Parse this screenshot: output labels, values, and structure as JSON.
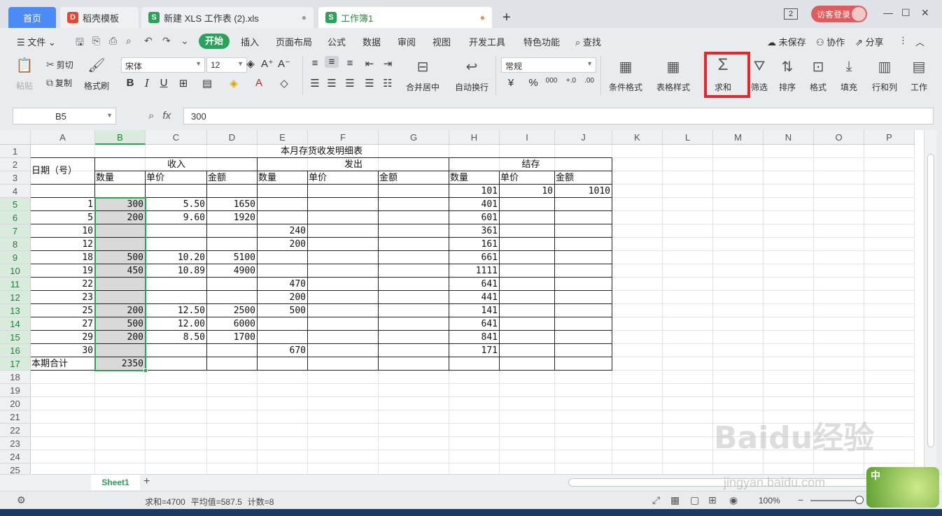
{
  "tabs": {
    "home": "首页",
    "daoke": "稻壳模板",
    "xls": "新建 XLS 工作表 (2).xls",
    "book": "工作簿1",
    "add": "+"
  },
  "titlebar": {
    "window_count": "2",
    "visitor_login": "访客登录"
  },
  "menu": {
    "file": "文件",
    "start": "开始",
    "insert": "插入",
    "page_layout": "页面布局",
    "formula": "公式",
    "data": "数据",
    "review": "审阅",
    "view": "视图",
    "developer": "开发工具",
    "features": "特色功能",
    "search": "查找",
    "unsaved": "未保存",
    "collab": "协作",
    "share": "分享"
  },
  "ribbon": {
    "paste": "粘贴",
    "cut": "剪切",
    "copy": "复制",
    "format_painter": "格式刷",
    "font_name": "宋体",
    "font_size": "12",
    "merge_center": "合并居中",
    "auto_wrap": "自动换行",
    "number_format": "常规",
    "cond_format": "条件格式",
    "table_style": "表格样式",
    "sum": "求和",
    "filter": "筛选",
    "sort": "排序",
    "format": "格式",
    "fill": "填充",
    "rows_cols": "行和列",
    "worksheet": "工作"
  },
  "formula_bar": {
    "cell_ref": "B5",
    "fx": "fx",
    "value": "300"
  },
  "columns": [
    "A",
    "B",
    "C",
    "D",
    "E",
    "F",
    "G",
    "H",
    "I",
    "J",
    "K",
    "L",
    "M",
    "N",
    "O",
    "P"
  ],
  "rows": [
    "1",
    "2",
    "3",
    "4",
    "5",
    "6",
    "7",
    "8",
    "9",
    "10",
    "11",
    "12",
    "13",
    "14",
    "15",
    "16",
    "17",
    "18",
    "19",
    "20",
    "21",
    "22",
    "23",
    "24",
    "25"
  ],
  "table": {
    "title": "本月存货收发明细表",
    "date_header": "日期（号）",
    "income": "收入",
    "issue": "发出",
    "balance": "结存",
    "qty": "数量",
    "price": "单价",
    "amount": "金额",
    "total_label": "本期合计",
    "opening": {
      "qty": "101",
      "price": "10",
      "amount": "1010"
    },
    "data_rows": [
      {
        "day": "1",
        "in_qty": "300",
        "in_price": "5.50",
        "in_amt": "1650",
        "out_qty": "",
        "bal_qty": "401"
      },
      {
        "day": "5",
        "in_qty": "200",
        "in_price": "9.60",
        "in_amt": "1920",
        "out_qty": "",
        "bal_qty": "601"
      },
      {
        "day": "10",
        "in_qty": "",
        "in_price": "",
        "in_amt": "",
        "out_qty": "240",
        "bal_qty": "361"
      },
      {
        "day": "12",
        "in_qty": "",
        "in_price": "",
        "in_amt": "",
        "out_qty": "200",
        "bal_qty": "161"
      },
      {
        "day": "18",
        "in_qty": "500",
        "in_price": "10.20",
        "in_amt": "5100",
        "out_qty": "",
        "bal_qty": "661"
      },
      {
        "day": "19",
        "in_qty": "450",
        "in_price": "10.89",
        "in_amt": "4900",
        "out_qty": "",
        "bal_qty": "1111"
      },
      {
        "day": "22",
        "in_qty": "",
        "in_price": "",
        "in_amt": "",
        "out_qty": "470",
        "bal_qty": "641"
      },
      {
        "day": "23",
        "in_qty": "",
        "in_price": "",
        "in_amt": "",
        "out_qty": "200",
        "bal_qty": "441"
      },
      {
        "day": "25",
        "in_qty": "200",
        "in_price": "12.50",
        "in_amt": "2500",
        "out_qty": "500",
        "bal_qty": "141"
      },
      {
        "day": "27",
        "in_qty": "500",
        "in_price": "12.00",
        "in_amt": "6000",
        "out_qty": "",
        "bal_qty": "641"
      },
      {
        "day": "29",
        "in_qty": "200",
        "in_price": "8.50",
        "in_amt": "1700",
        "out_qty": "",
        "bal_qty": "841"
      },
      {
        "day": "30",
        "in_qty": "",
        "in_price": "",
        "in_amt": "",
        "out_qty": "670",
        "bal_qty": "171"
      }
    ],
    "total_qty": "2350"
  },
  "sheets": {
    "active": "Sheet1",
    "add": "+"
  },
  "status": {
    "sum": "求和=4700",
    "avg": "平均值=587.5",
    "count": "计数=8",
    "zoom": "100%"
  },
  "watermark": {
    "brand": "Baidu经验",
    "url": "jingyan.baidu.com"
  },
  "ime": "中"
}
